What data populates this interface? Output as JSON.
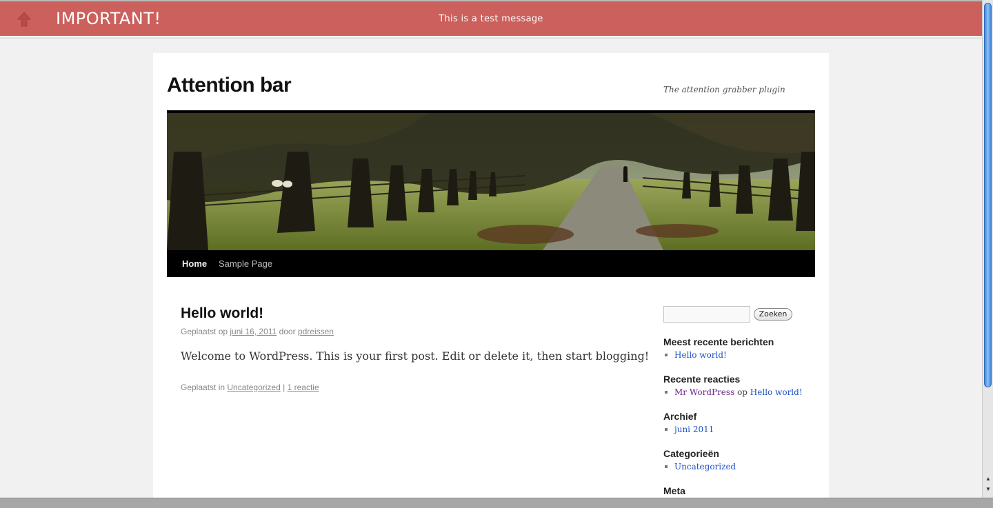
{
  "attention_bar": {
    "title": "IMPORTANT!",
    "message": "This is a test message",
    "background_color": "#cc605c",
    "icon": "up-arrow-icon"
  },
  "site": {
    "title": "Attention bar",
    "description": "The attention grabber plugin"
  },
  "nav": {
    "items": [
      "Home",
      "Sample Page"
    ]
  },
  "post": {
    "title": "Hello world!",
    "meta_prefix": "Geplaatst op",
    "date": "juni 16, 2011",
    "by": "door",
    "author": "pdreissen",
    "body": "Welcome to WordPress. This is your first post. Edit or delete it, then start blogging!",
    "foot_prefix": "Geplaatst in",
    "category": "Uncategorized",
    "separator": "|",
    "comments": "1 reactie"
  },
  "sidebar": {
    "search_button": "Zoeken",
    "search_value": "",
    "widgets": [
      {
        "title": "Meest recente berichten",
        "items": [
          "Hello world!"
        ]
      },
      {
        "title": "Recente reacties",
        "comment_author": "Mr WordPress",
        "comment_on": "op",
        "comment_post": "Hello world!"
      },
      {
        "title": "Archief",
        "items": [
          "juni 2011"
        ]
      },
      {
        "title": "Categorieën",
        "items": [
          "Uncategorized"
        ]
      },
      {
        "title": "Meta"
      }
    ]
  }
}
